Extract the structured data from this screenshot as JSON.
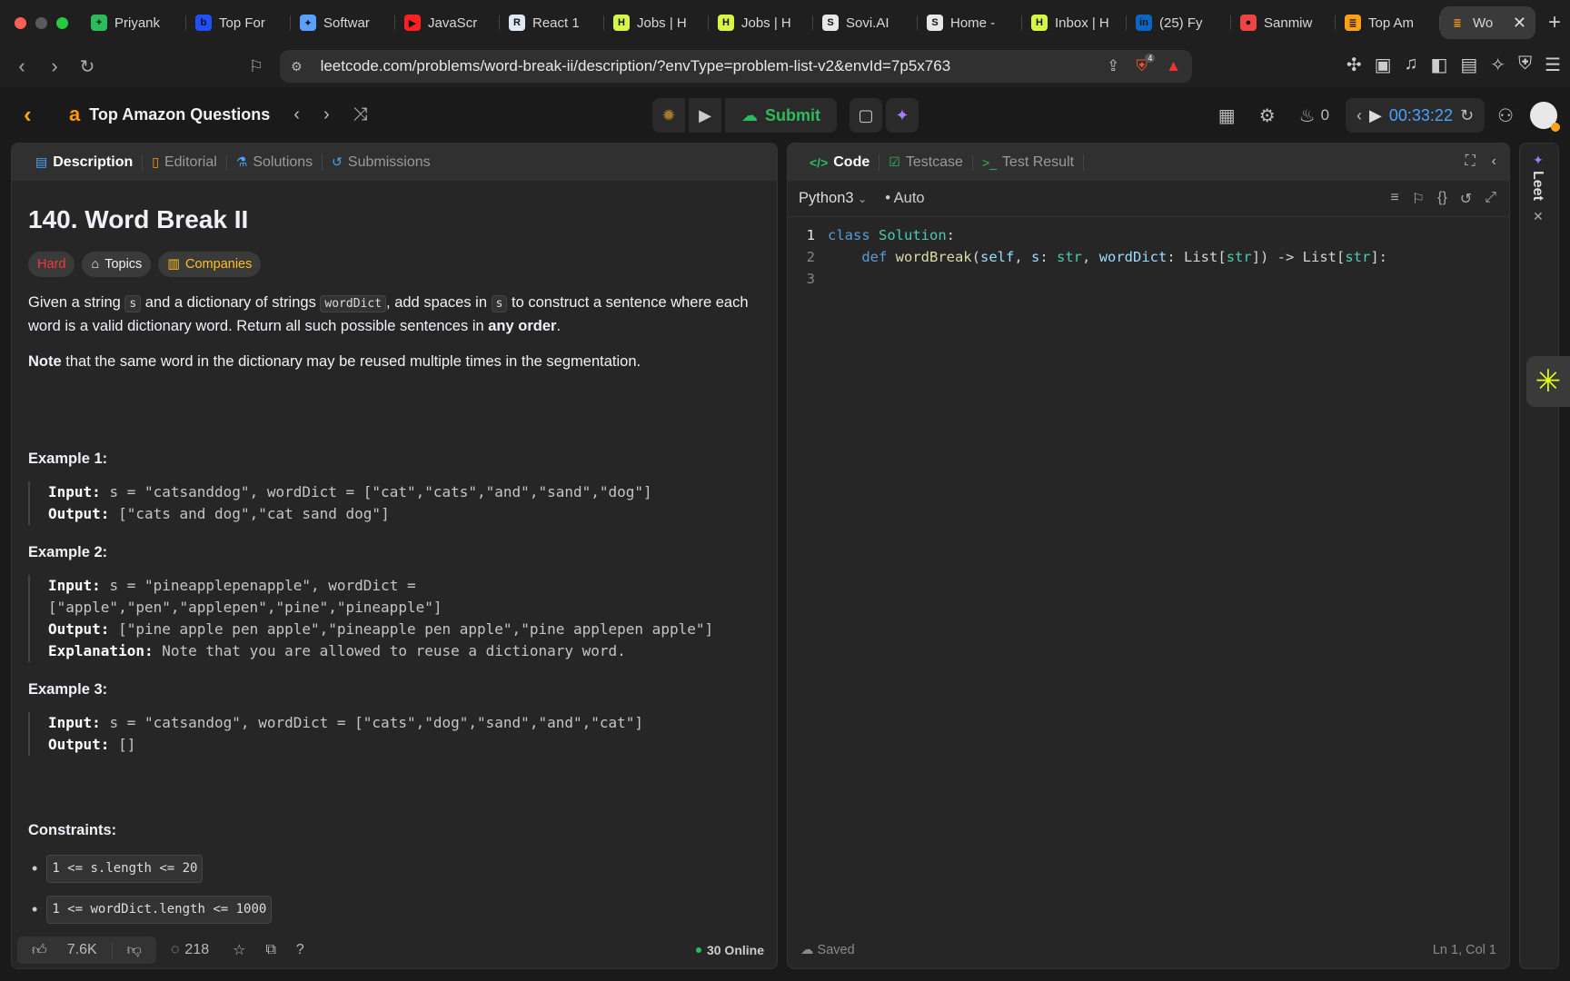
{
  "browser": {
    "tabs": [
      {
        "label": "Priyank",
        "fav": "+",
        "color": "#2cbb5d"
      },
      {
        "label": "Top For",
        "fav": "b",
        "color": "#1f4fff"
      },
      {
        "label": "Softwar",
        "fav": "✦",
        "color": "#5aa0ff"
      },
      {
        "label": "JavaScr",
        "fav": "▶",
        "color": "#ff2020"
      },
      {
        "label": "React 1",
        "fav": "R",
        "color": "#dfe8f5"
      },
      {
        "label": "Jobs | H",
        "fav": "H",
        "color": "#d7f545"
      },
      {
        "label": "Jobs | H",
        "fav": "H",
        "color": "#d7f545"
      },
      {
        "label": "Sovi.AI",
        "fav": "S",
        "color": "#e8e8e8"
      },
      {
        "label": "Home -",
        "fav": "S",
        "color": "#e8e8e8"
      },
      {
        "label": "Inbox | H",
        "fav": "H",
        "color": "#d7f545"
      },
      {
        "label": "(25) Fy",
        "fav": "in",
        "color": "#0a66c2"
      },
      {
        "label": "Sanmiw",
        "fav": "●",
        "color": "#e44"
      },
      {
        "label": "Top Am",
        "fav": "≣",
        "color": "#ffa116"
      }
    ],
    "active_tab": {
      "label": "Wo",
      "fav": "≣",
      "color": "#ffa116"
    },
    "url": "leetcode.com/problems/word-break-ii/description/?envType=problem-list-v2&envId=7p5x763",
    "shield_count": "4"
  },
  "header": {
    "problem_list_title": "Top Amazon Questions",
    "submit_label": "Submit",
    "streak_count": "0",
    "timer": "00:33:22"
  },
  "left_panel": {
    "tabs": [
      {
        "label": "Description",
        "icon": "document-icon"
      },
      {
        "label": "Editorial",
        "icon": "book-icon"
      },
      {
        "label": "Solutions",
        "icon": "flask-icon"
      },
      {
        "label": "Submissions",
        "icon": "history-icon"
      }
    ],
    "problem_title": "140. Word Break II",
    "difficulty": "Hard",
    "topics_label": "Topics",
    "companies_label": "Companies",
    "desc": {
      "p1_a": "Given a string ",
      "p1_code1": "s",
      "p1_b": " and a dictionary of strings ",
      "p1_code2": "wordDict",
      "p1_c": ", add spaces in ",
      "p1_code3": "s",
      "p1_d": " to construct a sentence where each word is a valid dictionary word. Return all such possible sentences in ",
      "p1_bold": "any order",
      "p1_e": ".",
      "p2_bold": "Note",
      "p2_rest": " that the same word in the dictionary may be reused multiple times in the segmentation."
    },
    "examples": [
      {
        "title": "Example 1:",
        "input": "s = \"catsanddog\", wordDict = [\"cat\",\"cats\",\"and\",\"sand\",\"dog\"]",
        "output": "[\"cats and dog\",\"cat sand dog\"]",
        "explanation": ""
      },
      {
        "title": "Example 2:",
        "input": "s = \"pineapplepenapple\", wordDict = [\"apple\",\"pen\",\"applepen\",\"pine\",\"pineapple\"]",
        "output": "[\"pine apple pen apple\",\"pineapple pen apple\",\"pine applepen apple\"]",
        "explanation": "Note that you are allowed to reuse a dictionary word."
      },
      {
        "title": "Example 3:",
        "input": "s = \"catsandog\", wordDict = [\"cats\",\"dog\",\"sand\",\"and\",\"cat\"]",
        "output": "[]",
        "explanation": ""
      }
    ],
    "labels": {
      "input": "Input:",
      "output": "Output:",
      "explanation": "Explanation:"
    },
    "constraints_title": "Constraints:",
    "constraints": [
      "1 <= s.length <= 20",
      "1 <= wordDict.length <= 1000"
    ],
    "footer": {
      "likes": "7.6K",
      "comments": "218",
      "online": "30 Online"
    }
  },
  "right_panel": {
    "tabs": [
      {
        "label": "Code",
        "icon": "code-icon"
      },
      {
        "label": "Testcase",
        "icon": "checkbox-icon"
      },
      {
        "label": "Test Result",
        "icon": "terminal-icon"
      }
    ],
    "language": "Python3",
    "mode": "Auto",
    "code_lines": [
      {
        "n": "1",
        "parts": [
          [
            "kw",
            "class "
          ],
          [
            "cls",
            "Solution"
          ],
          [
            "txt",
            ":"
          ]
        ]
      },
      {
        "n": "2",
        "parts": [
          [
            "txt",
            "    "
          ],
          [
            "kw",
            "def "
          ],
          [
            "fn",
            "wordBreak"
          ],
          [
            "txt",
            "("
          ],
          [
            "prm",
            "self"
          ],
          [
            "txt",
            ", "
          ],
          [
            "prm",
            "s"
          ],
          [
            "txt",
            ": "
          ],
          [
            "cls",
            "str"
          ],
          [
            "txt",
            ", "
          ],
          [
            "prm",
            "wordDict"
          ],
          [
            "txt",
            ": "
          ],
          [
            "txt",
            "List["
          ],
          [
            "cls",
            "str"
          ],
          [
            "txt",
            "]) -> List["
          ],
          [
            "cls",
            "str"
          ],
          [
            "txt",
            "]:"
          ]
        ]
      },
      {
        "n": "3",
        "parts": []
      }
    ],
    "saved_label": "Saved",
    "cursor_pos": "Ln 1, Col 1"
  },
  "side": {
    "leet_label": "Leet"
  }
}
